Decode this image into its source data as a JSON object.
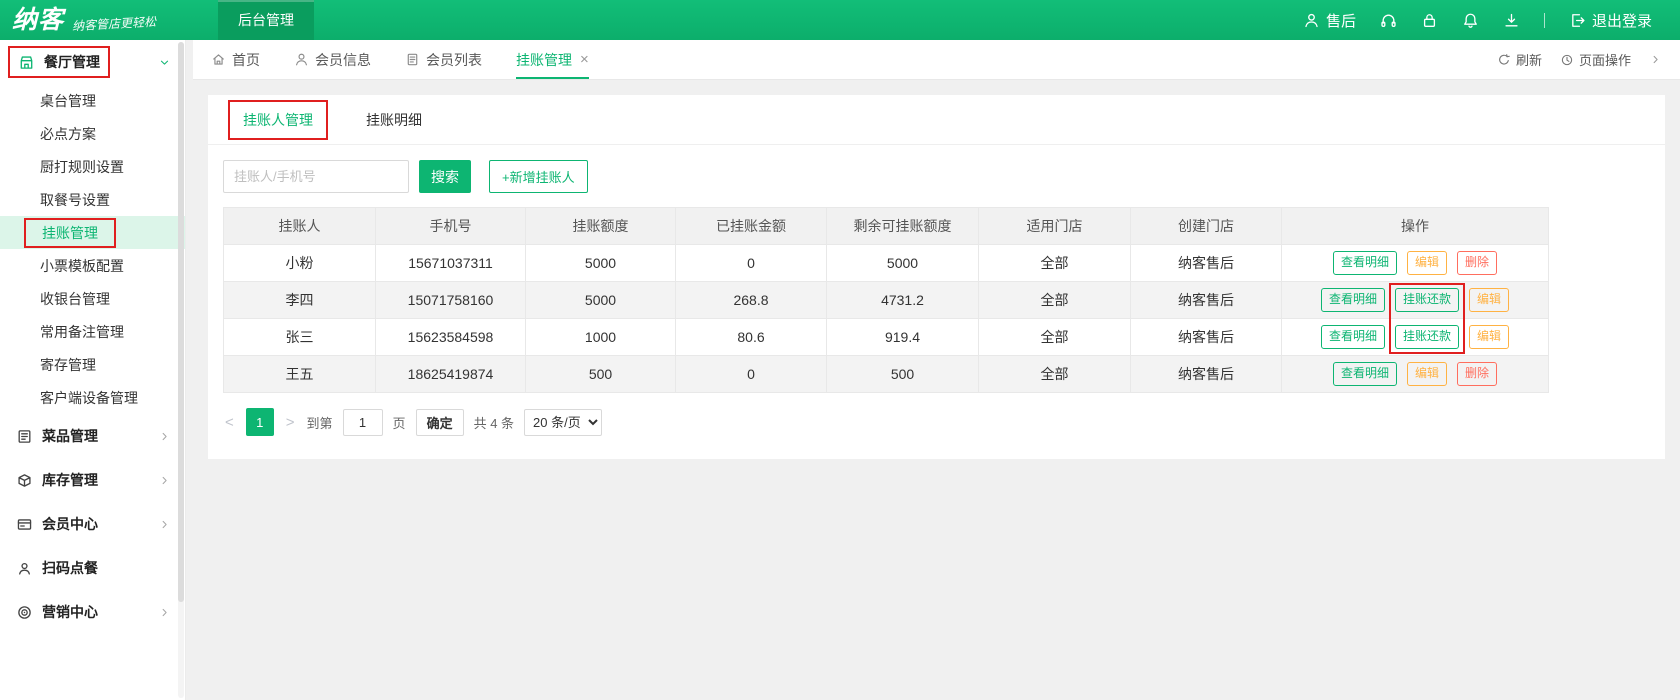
{
  "colors": {
    "brand": "#0DB572",
    "brand_dark": "#0A9D5E",
    "orange": "#FFB243",
    "red": "#FF6E5E",
    "annotation": "#E01F1F"
  },
  "header": {
    "logo": "纳客",
    "slogan": "纳客管店更轻松",
    "nav_tab": "后台管理",
    "after_sales": "售后",
    "logout": "退出登录"
  },
  "sidebar": {
    "items": [
      {
        "label": "餐厅管理",
        "name": "restaurant-management",
        "icon": "shop",
        "expanded": true,
        "annotated": true,
        "children": [
          {
            "label": "桌台管理",
            "name": "table-management"
          },
          {
            "label": "必点方案",
            "name": "must-order-plan"
          },
          {
            "label": "厨打规则设置",
            "name": "kitchen-print-rules"
          },
          {
            "label": "取餐号设置",
            "name": "pickup-number-settings"
          },
          {
            "label": "挂账管理",
            "name": "credit-account-management",
            "active": true,
            "annotated": true
          },
          {
            "label": "小票模板配置",
            "name": "receipt-template-config"
          },
          {
            "label": "收银台管理",
            "name": "cashier-management"
          },
          {
            "label": "常用备注管理",
            "name": "common-remarks-management"
          },
          {
            "label": "寄存管理",
            "name": "deposit-management"
          },
          {
            "label": "客户端设备管理",
            "name": "client-device-management"
          }
        ]
      },
      {
        "label": "菜品管理",
        "name": "dish-management",
        "icon": "dish",
        "arrow": true
      },
      {
        "label": "库存管理",
        "name": "inventory-management",
        "icon": "stock",
        "arrow": true
      },
      {
        "label": "会员中心",
        "name": "member-center",
        "icon": "member",
        "arrow": true
      },
      {
        "label": "扫码点餐",
        "name": "scan-order",
        "icon": "qr",
        "arrow": false
      },
      {
        "label": "营销中心",
        "name": "marketing-center",
        "icon": "marketing",
        "arrow": true
      }
    ]
  },
  "tabbar": {
    "tabs": [
      {
        "label": "首页",
        "name": "tab-home",
        "icon": "home"
      },
      {
        "label": "会员信息",
        "name": "tab-member-info",
        "icon": "person"
      },
      {
        "label": "会员列表",
        "name": "tab-member-list",
        "icon": "doc"
      },
      {
        "label": "挂账管理",
        "name": "tab-credit-management",
        "active": true,
        "closable": true
      }
    ],
    "refresh_label": "刷新",
    "page_ops_label": "页面操作"
  },
  "content": {
    "subtabs": [
      {
        "label": "挂账人管理",
        "name": "subtab-debtor-management",
        "active": true,
        "annotated": true
      },
      {
        "label": "挂账明细",
        "name": "subtab-credit-details"
      }
    ],
    "search": {
      "placeholder": "挂账人/手机号",
      "button": "搜索",
      "add_button": "+新增挂账人"
    },
    "table": {
      "columns": [
        "挂账人",
        "手机号",
        "挂账额度",
        "已挂账金额",
        "剩余可挂账额度",
        "适用门店",
        "创建门店",
        "操作"
      ],
      "rows": [
        {
          "cells": [
            "小粉",
            "15671037311",
            "5000",
            "0",
            "5000",
            "全部",
            "纳客售后"
          ],
          "actions": [
            {
              "label": "查看明细",
              "type": "green",
              "name": "view-detail-button"
            },
            {
              "label": "编辑",
              "type": "orange",
              "name": "edit-button"
            },
            {
              "label": "删除",
              "type": "red",
              "name": "delete-button"
            }
          ]
        },
        {
          "cells": [
            "李四",
            "15071758160",
            "5000",
            "268.8",
            "4731.2",
            "全部",
            "纳客售后"
          ],
          "actions": [
            {
              "label": "查看明细",
              "type": "green",
              "name": "view-detail-button"
            },
            {
              "label": "挂账还款",
              "type": "green",
              "name": "repay-button",
              "annotated": true
            },
            {
              "label": "编辑",
              "type": "orange",
              "name": "edit-button"
            }
          ]
        },
        {
          "cells": [
            "张三",
            "15623584598",
            "1000",
            "80.6",
            "919.4",
            "全部",
            "纳客售后"
          ],
          "actions": [
            {
              "label": "查看明细",
              "type": "green",
              "name": "view-detail-button"
            },
            {
              "label": "挂账还款",
              "type": "green",
              "name": "repay-button",
              "annotated": true
            },
            {
              "label": "编辑",
              "type": "orange",
              "name": "edit-button"
            }
          ]
        },
        {
          "cells": [
            "王五",
            "18625419874",
            "500",
            "0",
            "500",
            "全部",
            "纳客售后"
          ],
          "actions": [
            {
              "label": "查看明细",
              "type": "green",
              "name": "view-detail-button"
            },
            {
              "label": "编辑",
              "type": "orange",
              "name": "edit-button"
            },
            {
              "label": "删除",
              "type": "red",
              "name": "delete-button"
            }
          ]
        }
      ]
    },
    "pagination": {
      "current_page": "1",
      "goto_prefix": "到第",
      "goto_value": "1",
      "goto_suffix": "页",
      "confirm": "确定",
      "total": "共 4 条",
      "per_page": "20 条/页"
    }
  }
}
